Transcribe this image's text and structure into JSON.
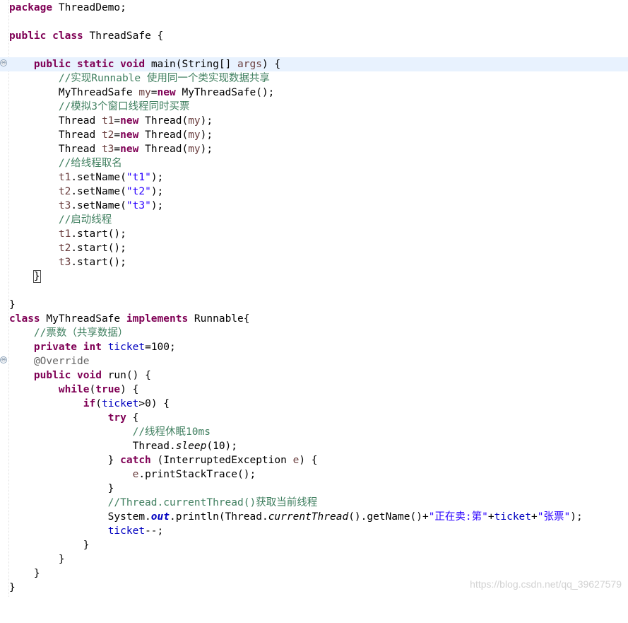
{
  "editor": {
    "file": {
      "l1_pkg_kw": "package",
      "l1_pkg_name": " ThreadDemo;",
      "l3_public": "public",
      "l3_class": "class",
      "l3_name": " ThreadSafe {",
      "l5_indent": "    ",
      "l5_public": "public",
      "l5_static": "static",
      "l5_void": "void",
      "l5_sig": " main(String[] ",
      "l5_args": "args",
      "l5_end": ") {",
      "l6_comment": "        //实现Runnable 使用同一个类实现数据共享",
      "l7_a": "        MyThreadSafe ",
      "l7_my": "my",
      "l7_eq": "=",
      "l7_new": "new",
      "l7_b": " MyThreadSafe();",
      "l8_comment": "        //模拟3个窗口线程同时买票",
      "l9_a": "        Thread ",
      "l9_var": "t1",
      "l9_eq": "=",
      "l9_new": "new",
      "l9_b": " Thread(",
      "l9_my": "my",
      "l9_c": ");",
      "l10_a": "        Thread ",
      "l10_var": "t2",
      "l10_eq": "=",
      "l10_new": "new",
      "l10_b": " Thread(",
      "l10_my": "my",
      "l10_c": ");",
      "l11_a": "        Thread ",
      "l11_var": "t3",
      "l11_eq": "=",
      "l11_new": "new",
      "l11_b": " Thread(",
      "l11_my": "my",
      "l11_c": ");",
      "l12_comment": "        //给线程取名",
      "l13_indent": "        ",
      "l13_var": "t1",
      "l13_a": ".setName(",
      "l13_str": "\"t1\"",
      "l13_b": ");",
      "l14_indent": "        ",
      "l14_var": "t2",
      "l14_a": ".setName(",
      "l14_str": "\"t2\"",
      "l14_b": ");",
      "l15_indent": "        ",
      "l15_var": "t3",
      "l15_a": ".setName(",
      "l15_str": "\"t3\"",
      "l15_b": ");",
      "l16_comment": "        //启动线程",
      "l17_indent": "        ",
      "l17_var": "t1",
      "l17_a": ".start();",
      "l18_indent": "        ",
      "l18_var": "t2",
      "l18_a": ".start();",
      "l19_indent": "        ",
      "l19_var": "t3",
      "l19_a": ".start();",
      "l20_indent": "    ",
      "l20_brace": "}",
      "l22_brace": "}",
      "l23_class": "class",
      "l23_name": " MyThreadSafe ",
      "l23_impl": "implements",
      "l23_b": " Runnable{",
      "l24_comment": "    //票数（共享数据）",
      "l25_indent": "    ",
      "l25_private": "private",
      "l25_int": "int",
      "l25_field": "ticket",
      "l25_b": "=100;",
      "l26_annot": "    @Override",
      "l27_indent": "    ",
      "l27_public": "public",
      "l27_void": "void",
      "l27_b": " run() {",
      "l28_indent": "        ",
      "l28_while": "while",
      "l28_a": "(",
      "l28_true": "true",
      "l28_b": ") {",
      "l29_indent": "            ",
      "l29_if": "if",
      "l29_a": "(",
      "l29_field": "ticket",
      "l29_b": ">0) {",
      "l30_indent": "                ",
      "l30_try": "try",
      "l30_b": " {",
      "l31_comment": "                    //线程休眠10ms",
      "l32_a": "                    Thread.",
      "l32_sleep": "sleep",
      "l32_b": "(10);",
      "l33_a": "                } ",
      "l33_catch": "catch",
      "l33_b": " (InterruptedException ",
      "l33_e": "e",
      "l33_c": ") {",
      "l34_indent": "                    ",
      "l34_e": "e",
      "l34_a": ".printStackTrace();",
      "l35_a": "                }",
      "l36_comment": "                //Thread.currentThread()获取当前线程",
      "l37_a": "                System.",
      "l37_out": "out",
      "l37_b": ".println(Thread.",
      "l37_ct": "currentThread",
      "l37_c": "().getName()+",
      "l37_s1": "\"正在卖:第\"",
      "l37_d": "+",
      "l37_field": "ticket",
      "l37_e": "+",
      "l37_s2": "\"张票\"",
      "l37_f": ");",
      "l38_indent": "                ",
      "l38_field": "ticket",
      "l38_a": "--;",
      "l39_a": "            }",
      "l40_a": "        }",
      "l41_a": "    }",
      "l42_a": "}"
    },
    "fold_markers": {
      "main_fold": "⊖",
      "run_fold": "⊖"
    }
  },
  "watermark": "https://blog.csdn.net/qq_39627579"
}
